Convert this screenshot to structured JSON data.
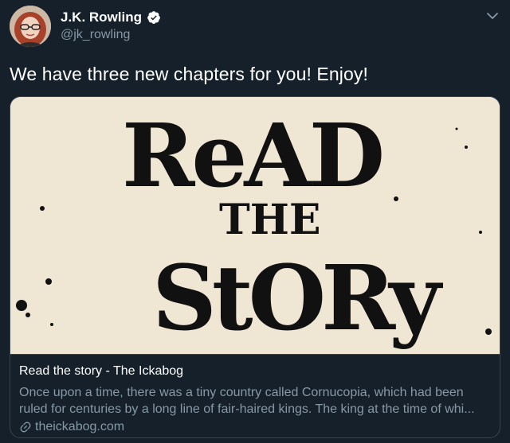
{
  "author": {
    "name": "J.K. Rowling",
    "handle": "@jk_rowling",
    "verified": true,
    "avatar_icon": "user-avatar"
  },
  "tweet": {
    "text": "We have three new chapters for you! Enjoy!"
  },
  "card": {
    "image": {
      "line1": "ReAD",
      "line2": "THE",
      "line3": "StORy"
    },
    "title": "Read the story - The Ickabog",
    "description_line1": "Once upon a time, there was a tiny country called Cornucopia, which had been",
    "description_line2": "ruled for centuries by a long line of fair-haired kings. The king at the time of whi...",
    "domain": "theickabog.com",
    "link_icon": "link-icon"
  },
  "colors": {
    "background": "#15202b",
    "border": "#38444d",
    "secondary_text": "#8899a6",
    "verified_badge": "#ffffff",
    "card_image_bg": "#efe6d4",
    "ink": "#111111"
  }
}
